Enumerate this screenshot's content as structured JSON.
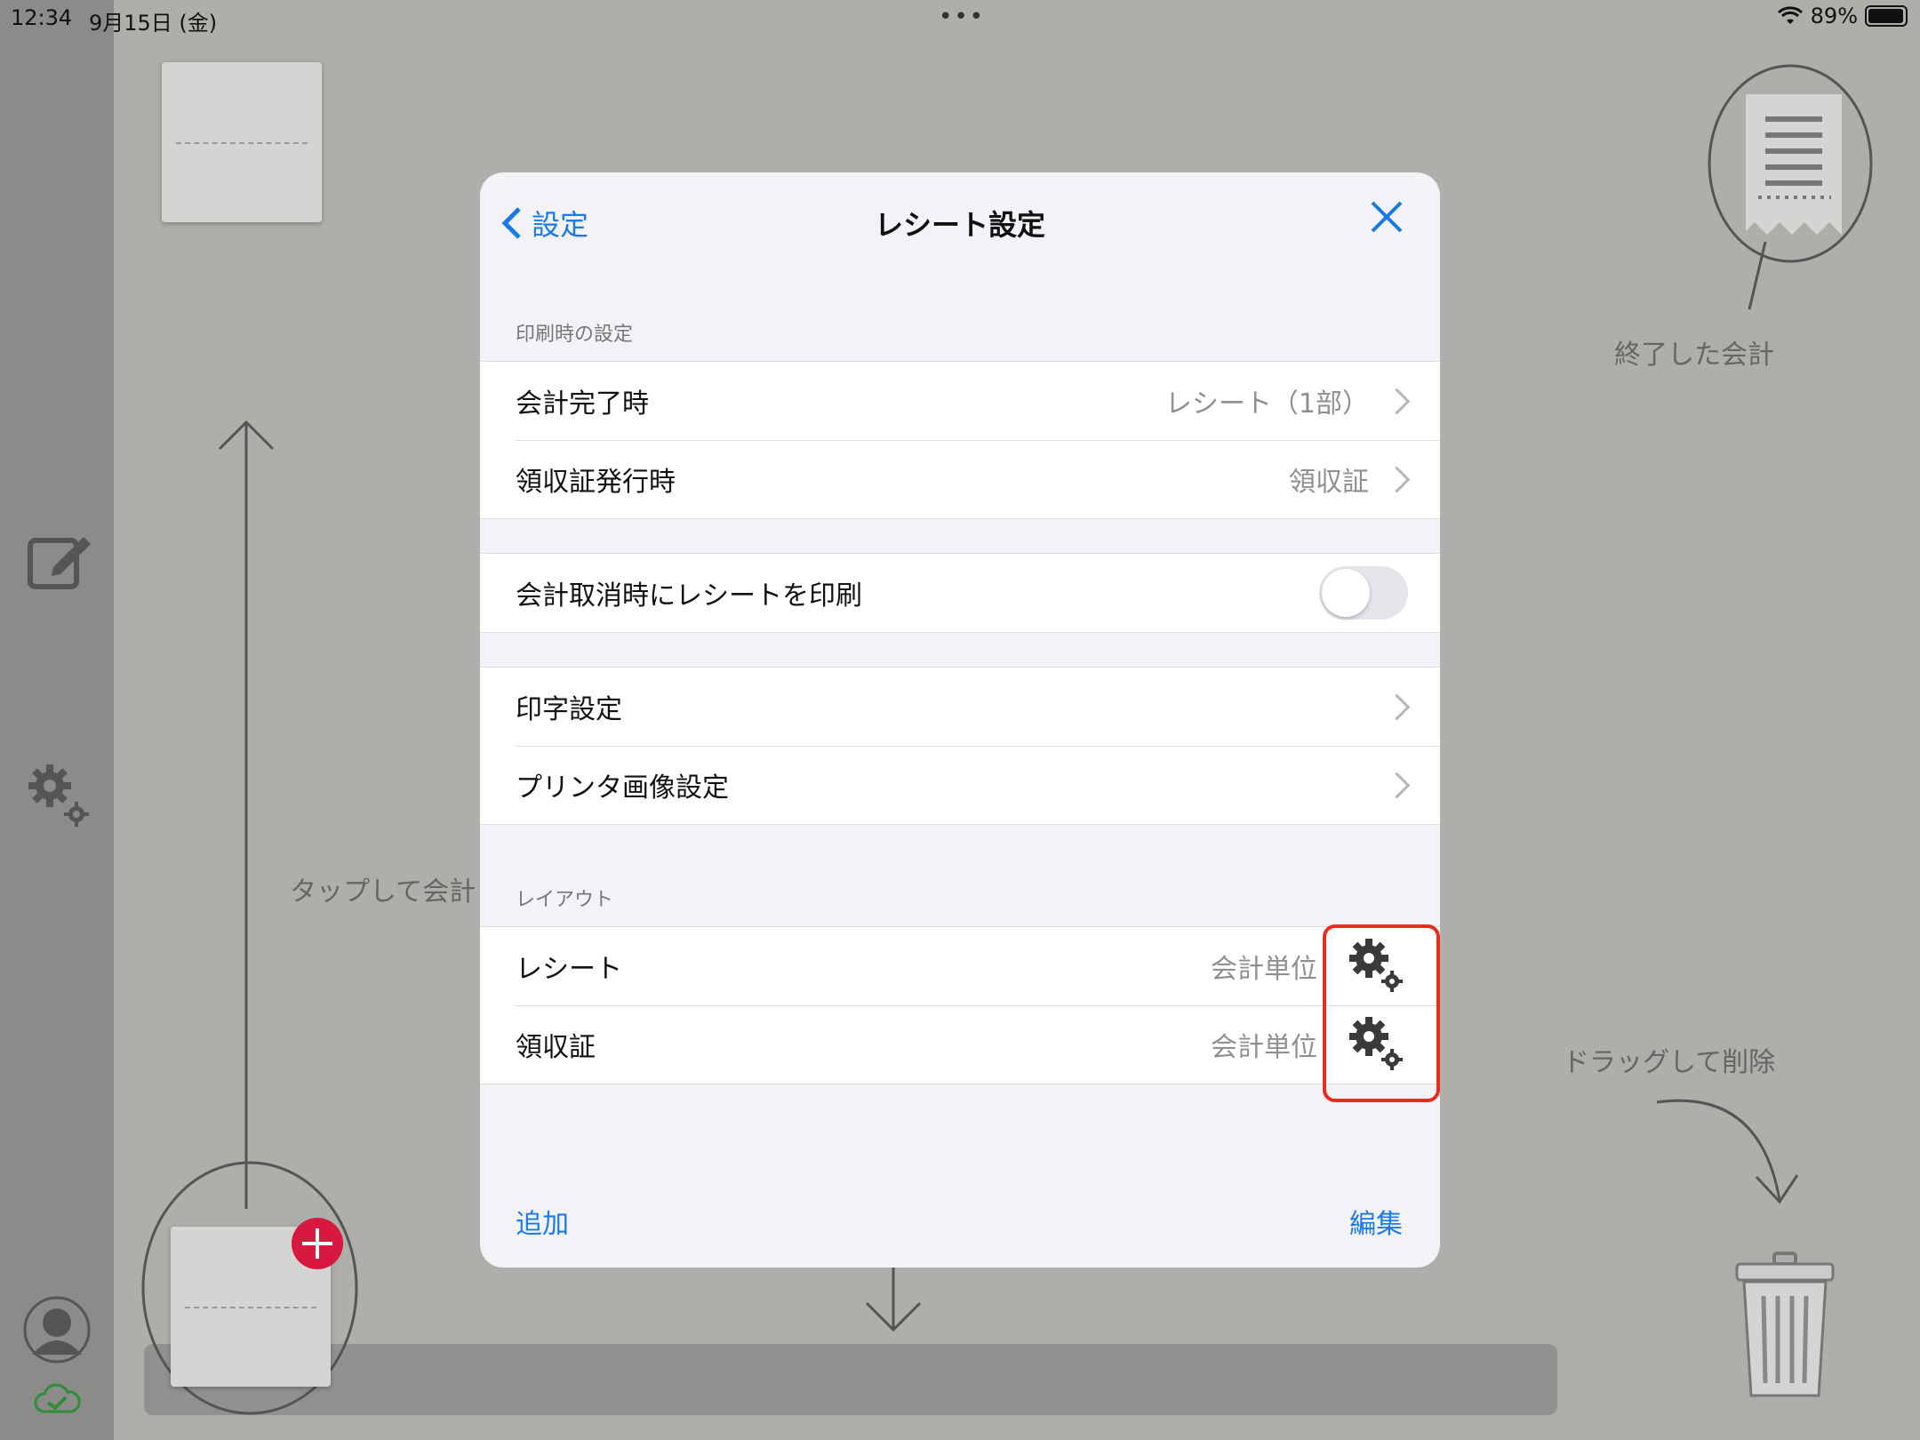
{
  "status": {
    "time": "12:34",
    "date": "9月15日 (金)",
    "battery": "89%"
  },
  "background": {
    "hint_tap": "タップして会計",
    "hint_finished": "終了した会計",
    "hint_drag": "ドラッグして削除"
  },
  "modal": {
    "back_label": "設定",
    "title": "レシート設定",
    "print_section": "印刷時の設定",
    "rows_print": [
      {
        "label": "会計完了時",
        "value": "レシート（1部）"
      },
      {
        "label": "領収証発行時",
        "value": "領収証"
      }
    ],
    "toggle_row": {
      "label": "会計取消時にレシートを印刷",
      "on": false
    },
    "rows_settings": [
      {
        "label": "印字設定"
      },
      {
        "label": "プリンタ画像設定"
      }
    ],
    "layout_section": "レイアウト",
    "rows_layout": [
      {
        "label": "レシート",
        "value": "会計単位"
      },
      {
        "label": "領収証",
        "value": "会計単位"
      }
    ],
    "add_label": "追加",
    "edit_label": "編集"
  },
  "colors": {
    "accent": "#1a7ae8",
    "highlight": "#ee2a1b",
    "add_badge": "#d7193f"
  }
}
